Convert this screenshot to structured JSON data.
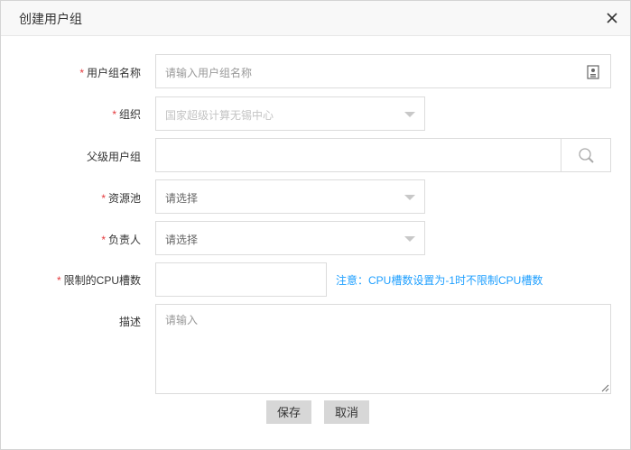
{
  "dialog": {
    "title": "创建用户组"
  },
  "form": {
    "group_name": {
      "label": "用户组名称",
      "required": "*",
      "placeholder": "请输入用户组名称"
    },
    "organization": {
      "label": "组织",
      "required": "*",
      "value": "国家超级计算无锡中心"
    },
    "parent_group": {
      "label": "父级用户组",
      "value": ""
    },
    "resource_pool": {
      "label": "资源池",
      "required": "*",
      "placeholder": "请选择"
    },
    "owner": {
      "label": "负责人",
      "required": "*",
      "placeholder": "请选择"
    },
    "cpu_limit": {
      "label": "限制的CPU槽数",
      "required": "*",
      "value": "",
      "note": "注意：CPU槽数设置为-1时不限制CPU槽数"
    },
    "description": {
      "label": "描述",
      "placeholder": "请输入"
    }
  },
  "actions": {
    "save_label": "保存",
    "cancel_label": "取消"
  },
  "colors": {
    "required": "#e4393c",
    "note": "#1e9fff",
    "button_bg": "#d7d7d7"
  },
  "icons": {
    "close": "close-icon",
    "id_card": "id-card-icon",
    "search": "search-icon",
    "dropdown": "chevron-down-icon"
  }
}
